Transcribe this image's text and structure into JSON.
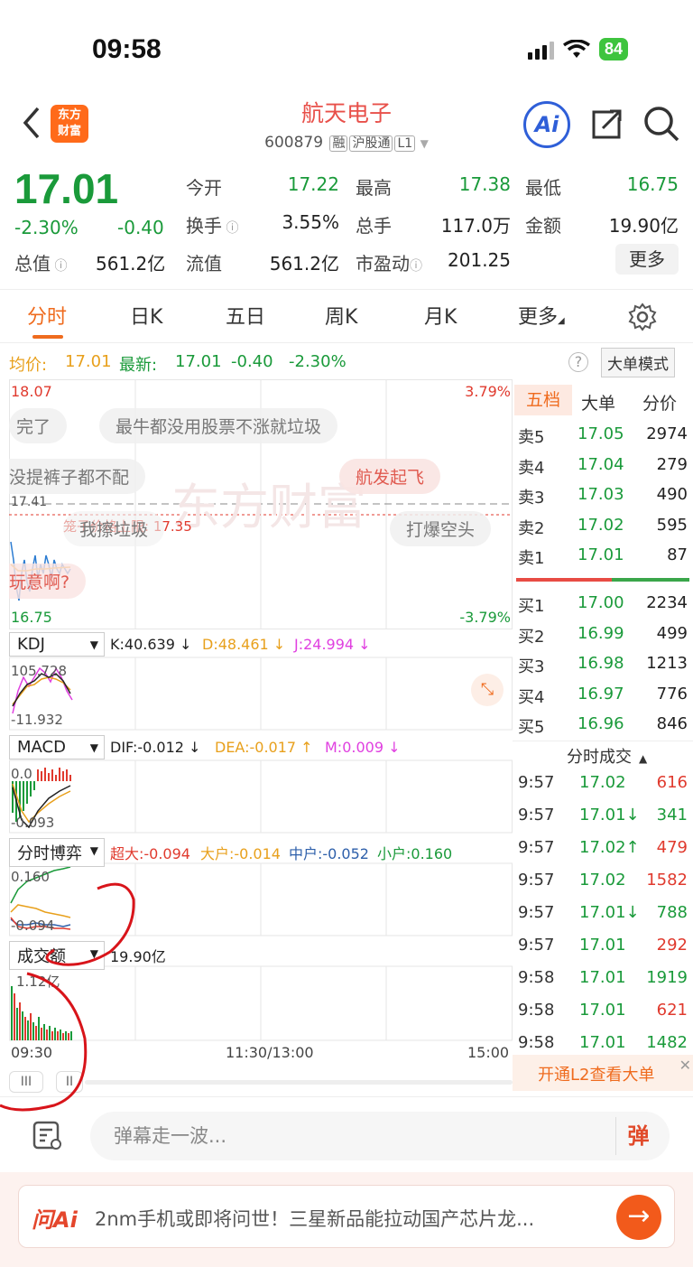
{
  "status_bar": {
    "time": "09:58",
    "battery": "84"
  },
  "header": {
    "logo_line1": "东方",
    "logo_line2": "财富",
    "stock_name": "航天电子",
    "stock_code": "600879",
    "tags": [
      "融",
      "沪股通",
      "L1"
    ],
    "ai_label": "Ai"
  },
  "quote": {
    "price": "17.01",
    "pct": "-2.30%",
    "change": "-0.40",
    "market_cap_label": "总值",
    "market_cap": "561.2亿",
    "fields": [
      {
        "label": "今开",
        "value": "17.22",
        "color": "#1a9a3a"
      },
      {
        "label": "最高",
        "value": "17.38",
        "color": "#1a9a3a"
      },
      {
        "label": "最低",
        "value": "16.75",
        "color": "#1a9a3a"
      },
      {
        "label": "换手",
        "value": "3.55%",
        "color": "#222"
      },
      {
        "label": "总手",
        "value": "117.0万",
        "color": "#222"
      },
      {
        "label": "金额",
        "value": "19.90亿",
        "color": "#222"
      },
      {
        "label": "流值",
        "value": "561.2亿",
        "color": "#222"
      },
      {
        "label": "市盈动",
        "value": "201.25",
        "color": "#222"
      }
    ],
    "more_label": "更多"
  },
  "tabs": [
    "分时",
    "日K",
    "五日",
    "周K",
    "月K",
    "更多"
  ],
  "info": {
    "avg_label": "均价:",
    "avg": "17.01",
    "last_label": "最新:",
    "last": "17.01",
    "chg": "-0.40",
    "pct": "-2.30%",
    "mode_label": "大单模式"
  },
  "chart": {
    "price_high": "18.07",
    "price_low": "16.75",
    "pct_high": "3.79%",
    "pct_low": "-3.79%",
    "prev_close": "17.41",
    "limit_label": "笼子价格上限: 17.35",
    "kdj": {
      "name": "KDJ",
      "k": "K:40.639 ↓",
      "d": "D:48.461 ↓",
      "j": "J:24.994 ↓",
      "top": "105.728",
      "bottom": "-11.932"
    },
    "macd": {
      "name": "MACD",
      "dif": "DIF:-0.012 ↓",
      "dea": "DEA:-0.017 ↑",
      "m": "M:0.009 ↓",
      "top": "0.0",
      "bottom": "-0.093"
    },
    "game": {
      "name": "分时博弈",
      "super": "超大:-0.094",
      "big": "大户:-0.014",
      "mid": "中户:-0.052",
      "small": "小户:0.160",
      "top": "0.160",
      "bottom": "-0.094"
    },
    "volume": {
      "name": "成交额",
      "total": "19.90亿",
      "scale": "1.12亿"
    },
    "times": [
      "09:30",
      "11:30/13:00",
      "15:00"
    ]
  },
  "danmaku": [
    "完了",
    "最牛都没用股票不涨就垃圾",
    "没提裤子都不配",
    "航发起飞",
    "我擦垃圾",
    "打爆空头",
    "玩意啊?"
  ],
  "book": {
    "tabs": [
      "五档",
      "大单",
      "分价"
    ],
    "asks": [
      {
        "label": "卖5",
        "price": "17.05",
        "vol": "2974"
      },
      {
        "label": "卖4",
        "price": "17.04",
        "vol": "279"
      },
      {
        "label": "卖3",
        "price": "17.03",
        "vol": "490"
      },
      {
        "label": "卖2",
        "price": "17.02",
        "vol": "595"
      },
      {
        "label": "卖1",
        "price": "17.01",
        "vol": "87"
      }
    ],
    "bids": [
      {
        "label": "买1",
        "price": "17.00",
        "vol": "2234"
      },
      {
        "label": "买2",
        "price": "16.99",
        "vol": "499"
      },
      {
        "label": "买3",
        "price": "16.98",
        "vol": "1213"
      },
      {
        "label": "买4",
        "price": "16.97",
        "vol": "776"
      },
      {
        "label": "买5",
        "price": "16.96",
        "vol": "846"
      }
    ],
    "trades_title": "分时成交",
    "trades": [
      {
        "time": "9:57",
        "price": "17.02",
        "vol": "616",
        "color": "#e03a2e"
      },
      {
        "time": "9:57",
        "price": "17.01↓",
        "vol": "341",
        "color": "#1a9a3a"
      },
      {
        "time": "9:57",
        "price": "17.02↑",
        "vol": "479",
        "color": "#e03a2e"
      },
      {
        "time": "9:57",
        "price": "17.02",
        "vol": "1582",
        "color": "#e03a2e"
      },
      {
        "time": "9:57",
        "price": "17.01↓",
        "vol": "788",
        "color": "#1a9a3a"
      },
      {
        "time": "9:57",
        "price": "17.01",
        "vol": "292",
        "color": "#e03a2e"
      },
      {
        "time": "9:58",
        "price": "17.01",
        "vol": "1919",
        "color": "#1a9a3a"
      },
      {
        "time": "9:58",
        "price": "17.01",
        "vol": "621",
        "color": "#e03a2e"
      },
      {
        "time": "9:58",
        "price": "17.01",
        "vol": "1482",
        "color": "#1a9a3a"
      }
    ],
    "l2_banner": "开通L2查看大单"
  },
  "comment": {
    "placeholder": "弹幕走一波...",
    "danmu_btn": "弹"
  },
  "ask": {
    "logo": "问Ai",
    "text": "2nm手机或即将问世！三星新品能拉动国产芯片龙..."
  },
  "colors": {
    "accent": "#ef6b1e",
    "up": "#e03a2e",
    "down": "#1a9a3a"
  }
}
